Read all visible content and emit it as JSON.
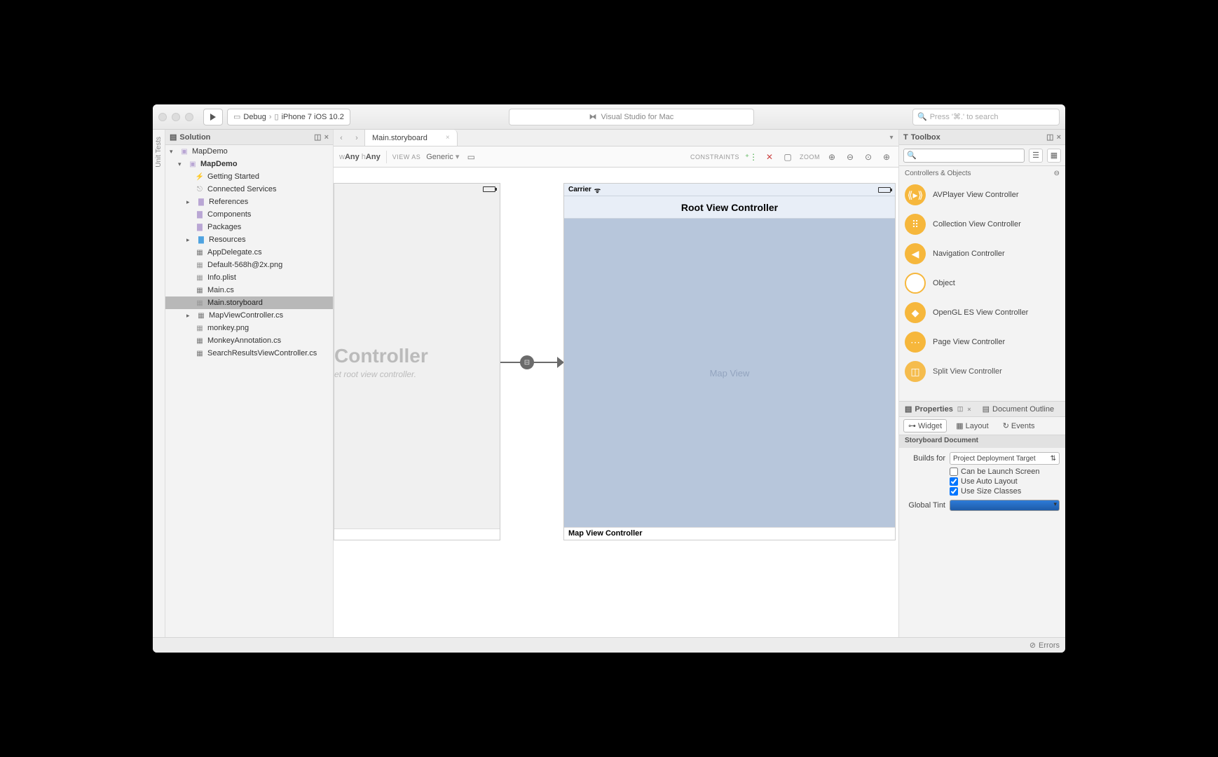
{
  "titlebar": {
    "config": "Debug",
    "device": "iPhone 7 iOS 10.2",
    "app_title": "Visual Studio for Mac",
    "search_placeholder": "Press '⌘.' to search"
  },
  "leftgutter": {
    "label": "Unit Tests"
  },
  "solution": {
    "title": "Solution",
    "root": "MapDemo",
    "project": "MapDemo",
    "items": [
      {
        "label": "Getting Started",
        "icon": "bolt"
      },
      {
        "label": "Connected Services",
        "icon": "bolt"
      },
      {
        "label": "References",
        "icon": "folder",
        "expandable": true
      },
      {
        "label": "Components",
        "icon": "folder"
      },
      {
        "label": "Packages",
        "icon": "folder"
      },
      {
        "label": "Resources",
        "icon": "folder-blue",
        "expandable": true
      },
      {
        "label": "AppDelegate.cs",
        "icon": "cs"
      },
      {
        "label": "Default-568h@2x.png",
        "icon": "file"
      },
      {
        "label": "Info.plist",
        "icon": "file"
      },
      {
        "label": "Main.cs",
        "icon": "cs"
      },
      {
        "label": "Main.storyboard",
        "icon": "file",
        "selected": true
      },
      {
        "label": "MapViewController.cs",
        "icon": "cs",
        "expandable": true
      },
      {
        "label": "monkey.png",
        "icon": "file"
      },
      {
        "label": "MonkeyAnnotation.cs",
        "icon": "cs"
      },
      {
        "label": "SearchResultsViewController.cs",
        "icon": "cs"
      }
    ]
  },
  "editor": {
    "tab": "Main.storyboard",
    "size_w_prefix": "w",
    "size_w": "Any",
    "size_h_prefix": "h",
    "size_h": "Any",
    "view_as_label": "VIEW AS",
    "view_as": "Generic",
    "constraints_label": "CONSTRAINTS",
    "zoom_label": "ZOOM"
  },
  "scene1": {
    "big": "Controller",
    "sub": "et root view controller."
  },
  "scene2": {
    "carrier": "Carrier",
    "title": "Root View Controller",
    "map_label": "Map View",
    "bottom_label": "Map View Controller"
  },
  "toolbox": {
    "title": "Toolbox",
    "section": "Controllers & Objects",
    "items": [
      "AVPlayer View Controller",
      "Collection View Controller",
      "Navigation Controller",
      "Object",
      "OpenGL ES View Controller",
      "Page View Controller",
      "Split View Controller"
    ]
  },
  "properties": {
    "tab_properties": "Properties",
    "tab_outline": "Document Outline",
    "sub_widget": "Widget",
    "sub_layout": "Layout",
    "sub_events": "Events",
    "section": "Storyboard Document",
    "builds_for_label": "Builds for",
    "builds_for": "Project Deployment Target",
    "cb_launch": "Can be Launch Screen",
    "cb_autolayout": "Use Auto Layout",
    "cb_sizeclasses": "Use Size Classes",
    "tint_label": "Global Tint"
  },
  "statusbar": {
    "errors": "Errors"
  }
}
